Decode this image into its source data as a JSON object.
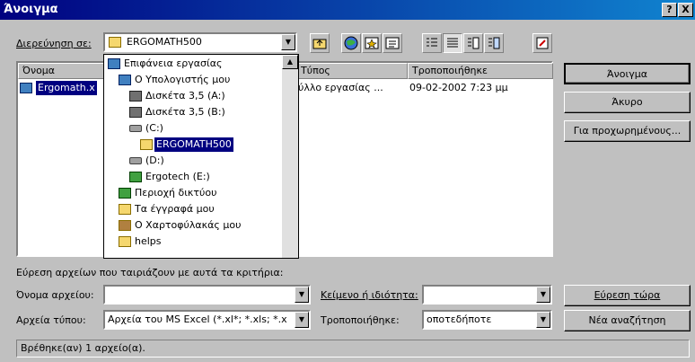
{
  "window": {
    "title": "Άνοιγμα",
    "help_glyph": "?",
    "close_glyph": "X"
  },
  "lookin": {
    "label": "Διερεύνηση σε:",
    "value": "ERGOMATH500",
    "arrow": "▼"
  },
  "filelist": {
    "columns": [
      "Όνομα",
      "Τύπος",
      "Τροποποιήθηκε"
    ],
    "row": {
      "name": "Ergomath.x",
      "type": "ύλλο εργασίας ...",
      "modified": "09-02-2002 7:23 μμ"
    }
  },
  "dropdown": {
    "items": [
      {
        "label": "Επιφάνεια εργασίας",
        "icon": "desktop-icon"
      },
      {
        "label": "Ο Υπολογιστής μου",
        "icon": "computer-icon"
      },
      {
        "label": "Δισκέτα 3,5 (A:)",
        "icon": "floppy-icon"
      },
      {
        "label": "Δισκέτα 3,5 (B:)",
        "icon": "floppy-icon"
      },
      {
        "label": "(C:)",
        "icon": "drive-icon"
      },
      {
        "label": "ERGOMATH500",
        "icon": "folder-icon",
        "selected": true
      },
      {
        "label": "(D:)",
        "icon": "drive-icon"
      },
      {
        "label": "Ergotech (E:)",
        "icon": "network-drive-icon"
      },
      {
        "label": "Περιοχή δικτύου",
        "icon": "network-icon"
      },
      {
        "label": "Τα έγγραφά μου",
        "icon": "folder-icon"
      },
      {
        "label": "Ο Χαρτοφύλακάς μου",
        "icon": "briefcase-icon"
      },
      {
        "label": "helps",
        "icon": "folder-icon"
      }
    ],
    "scroll_up": "▲"
  },
  "buttons": {
    "open": "Άνοιγμα",
    "cancel": "Άκυρο",
    "advanced": "Για προχωρημένους..."
  },
  "search": {
    "heading": "Εύρεση αρχείων που ταιριάζουν με αυτά τα κριτήρια:",
    "filename_label": "Όνομα αρχείου:",
    "filename_value": "",
    "filetype_label": "Αρχεία τύπου:",
    "filetype_value": "Αρχεία του MS Excel (*.xl*; *.xls; *.x",
    "property_label": "Κείμενο ή ιδιότητα:",
    "property_value": "",
    "modified_label": "Τροποποιήθηκε:",
    "modified_value": "οποτεδήποτε",
    "find_now": "Εύρεση τώρα",
    "new_search": "Νέα αναζήτηση"
  },
  "status": {
    "text": "Βρέθηκε(αν) 1 αρχείο(α)."
  }
}
